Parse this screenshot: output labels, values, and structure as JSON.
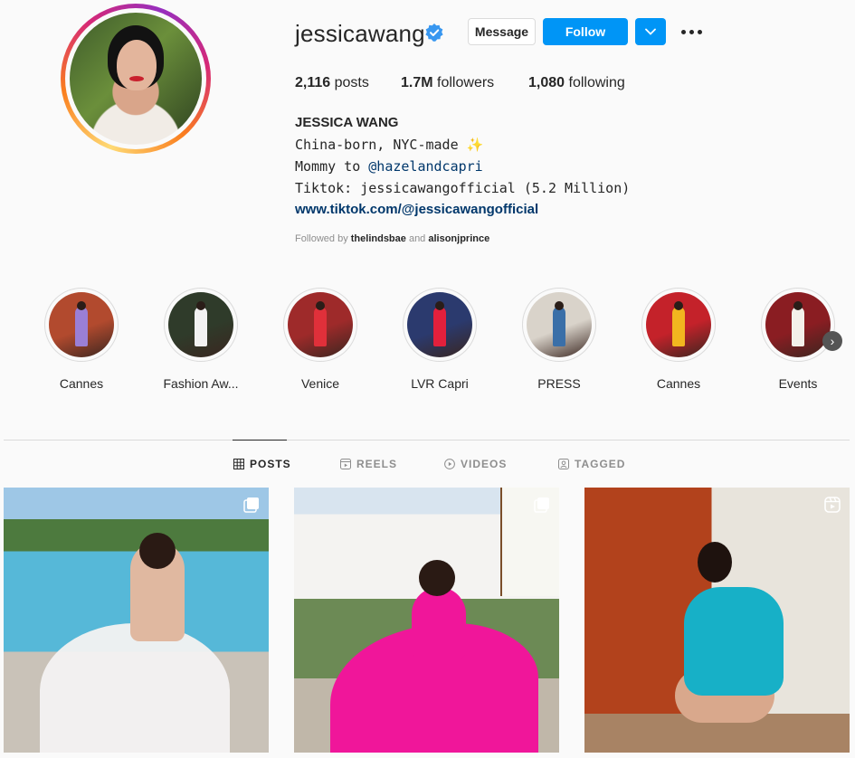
{
  "profile": {
    "username": "jessicawang",
    "verified": true,
    "message_label": "Message",
    "follow_label": "Follow",
    "stats": {
      "posts_count": "2,116",
      "posts_label": "posts",
      "followers_count": "1.7M",
      "followers_label": "followers",
      "following_count": "1,080",
      "following_label": "following"
    },
    "full_name": "JESSICA WANG",
    "bio": {
      "line1": "China-born, NYC-made ✨",
      "line2_prefix": "Mommy to ",
      "line2_mention": "@hazelandcapri",
      "line3": "Tiktok: jessicawangofficial (5.2 Million)",
      "link": "www.tiktok.com/@jessicawangofficial"
    },
    "followed_by": {
      "prefix": "Followed by ",
      "user1": "thelindsbae",
      "conjunction": " and ",
      "user2": "alisonjprince"
    }
  },
  "highlights": [
    {
      "label": "Cannes",
      "bg": "#b24a2e",
      "accent": "#9a7fd6"
    },
    {
      "label": "Fashion Aw...",
      "bg": "#2f3b2a",
      "accent": "#f2f2f2"
    },
    {
      "label": "Venice",
      "bg": "#9e2a2a",
      "accent": "#e0303a"
    },
    {
      "label": "LVR Capri",
      "bg": "#2b3a6e",
      "accent": "#e2203c"
    },
    {
      "label": "PRESS",
      "bg": "#d9d3ca",
      "accent": "#3a6fa8"
    },
    {
      "label": "Cannes",
      "bg": "#c4222a",
      "accent": "#f2b61f"
    },
    {
      "label": "Events",
      "bg": "#8a1d22",
      "accent": "#f4f0ea"
    }
  ],
  "tabs": [
    {
      "label": "POSTS",
      "icon": "grid-icon",
      "active": true
    },
    {
      "label": "REELS",
      "icon": "reels-icon",
      "active": false
    },
    {
      "label": "VIDEOS",
      "icon": "play-icon",
      "active": false
    },
    {
      "label": "TAGGED",
      "icon": "tagged-icon",
      "active": false
    }
  ],
  "posts": [
    {
      "badge": "carousel-icon"
    },
    {
      "badge": "carousel-icon"
    },
    {
      "badge": "reel-icon"
    }
  ],
  "colors": {
    "accent": "#0095f6",
    "link": "#00376b",
    "verified": "#3897f0"
  }
}
